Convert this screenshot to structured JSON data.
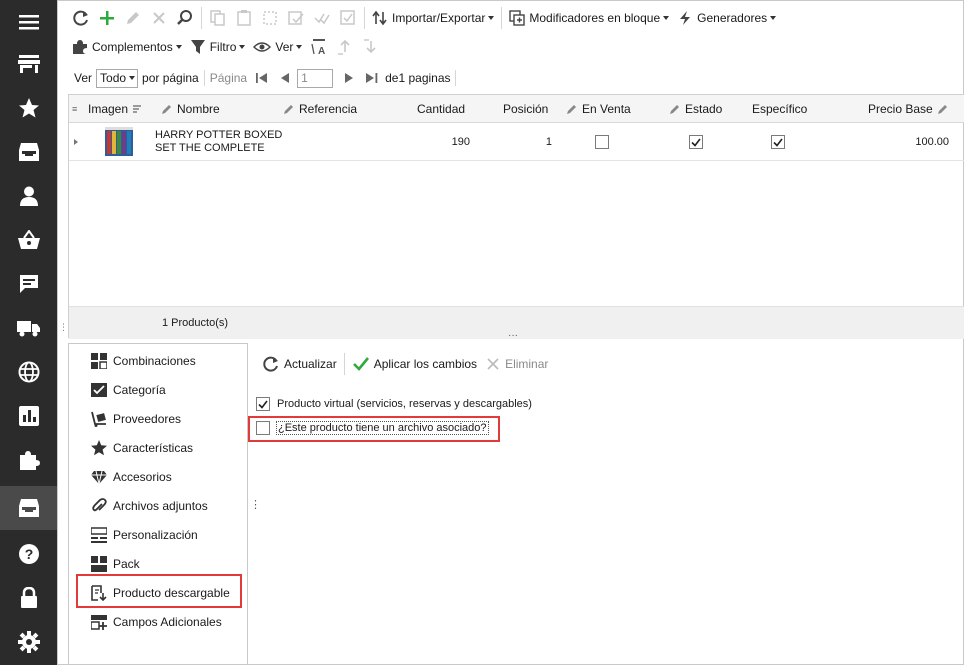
{
  "toolbar_main": {
    "import_export": "Importar/Exportar",
    "bulk_modifiers": "Modificadores en bloque",
    "generators": "Generadores"
  },
  "toolbar_second": {
    "addons": "Complementos",
    "filter": "Filtro",
    "view": "Ver"
  },
  "pager": {
    "show_label": "Ver",
    "show_value": "Todo",
    "per_page": "por página",
    "page_label": "Página",
    "page_value": "1",
    "of_pages": "de1 paginas"
  },
  "grid": {
    "columns": [
      "Imagen",
      "Nombre",
      "Referencia",
      "Cantidad",
      "Posición",
      "En Venta",
      "Estado",
      "Específico",
      "Precio Base"
    ],
    "rows": [
      {
        "name_line1": "HARRY POTTER BOXED",
        "name_line2": "SET THE COMPLETE",
        "reference": "",
        "quantity": "190",
        "position": "1",
        "on_sale": false,
        "status": true,
        "specific": true,
        "base_price": "100.00"
      }
    ],
    "footer_count": "1 Producto(s)"
  },
  "side_menu": {
    "items": [
      {
        "label": "Combinaciones",
        "icon": "combinations-icon"
      },
      {
        "label": "Categoría",
        "icon": "category-icon"
      },
      {
        "label": "Proveedores",
        "icon": "suppliers-icon"
      },
      {
        "label": "Características",
        "icon": "features-star-icon"
      },
      {
        "label": "Accesorios",
        "icon": "accessories-diamond-icon"
      },
      {
        "label": "Archivos adjuntos",
        "icon": "attachment-icon"
      },
      {
        "label": "Personalización",
        "icon": "customization-icon"
      },
      {
        "label": "Pack",
        "icon": "pack-icon"
      },
      {
        "label": "Producto descargable",
        "icon": "download-file-icon"
      },
      {
        "label": "Campos Adicionales",
        "icon": "additional-fields-icon"
      }
    ],
    "selected": "Producto descargable"
  },
  "detail": {
    "refresh": "Actualizar",
    "apply": "Aplicar los cambios",
    "delete": "Eliminar",
    "virtual_product_label": "Producto virtual (servicios, reservas y descargables)",
    "virtual_product_checked": true,
    "has_file_label": "¿Este producto tiene un archivo asociado?",
    "has_file_checked": false
  },
  "colors": {
    "rail_bg": "#2b2b2b",
    "highlight": "#e03a3a",
    "green": "#2eaa3c"
  }
}
